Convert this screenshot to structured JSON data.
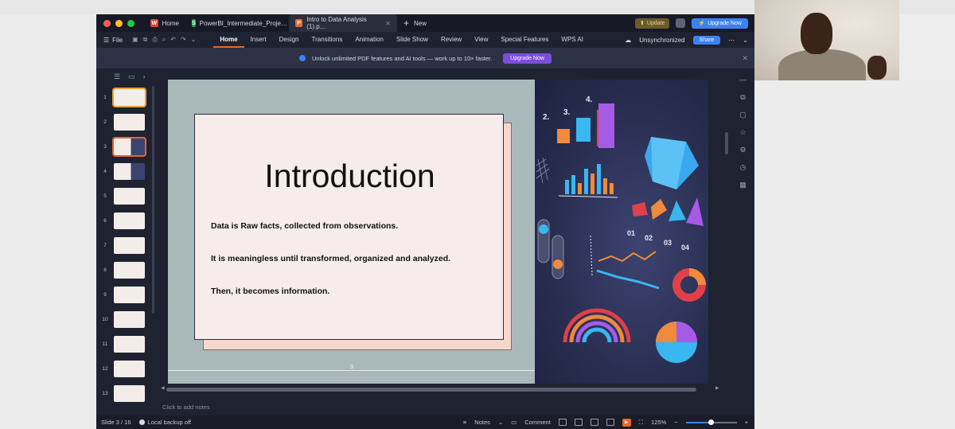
{
  "window": {
    "tabs": [
      {
        "label": "Home",
        "icon": "wps-logo-icon"
      },
      {
        "label": "PowerBI_Intermediate_Proje…",
        "icon": "spreadsheet-icon"
      },
      {
        "label": "Intro to Data Analysis (1).p…",
        "icon": "presentation-icon"
      }
    ],
    "new_tab_label": "New",
    "update_label": "Update",
    "upgrade_now_label": "Upgrade Now"
  },
  "menu": {
    "file_label": "File",
    "items": [
      "Home",
      "Insert",
      "Design",
      "Transitions",
      "Animation",
      "Slide Show",
      "Review",
      "View",
      "Special Features",
      "WPS AI"
    ],
    "active": "Home",
    "sync_status": "Unsynchronized",
    "share_label": "Share"
  },
  "banner": {
    "text": "Unlock unlimited PDF features and AI tools — work up to 10× faster.",
    "button_label": "Upgrade Now"
  },
  "thumbnails": {
    "numbers": [
      "1",
      "2",
      "3",
      "4",
      "5",
      "6",
      "7",
      "8",
      "9",
      "10",
      "11",
      "12",
      "13"
    ],
    "current": 3
  },
  "slide": {
    "title": "Introduction",
    "lines": [
      "Data is Raw facts, collected from observations.",
      "It is meaningless until transformed, organized and analyzed.",
      "Then, it becomes information."
    ],
    "page_number": "3",
    "art_labels": {
      "steps": [
        "2.",
        "3.",
        "4."
      ],
      "codes": [
        "01",
        "02",
        "03",
        "04"
      ]
    }
  },
  "notes_placeholder": "Click to add notes",
  "status": {
    "slide_info": "Slide 3 / 16",
    "backup": "Local backup off",
    "notes_label": "Notes",
    "comment_label": "Comment",
    "zoom": "125%"
  },
  "colors": {
    "accent": "#e8662a",
    "primary_blue": "#3b82f6",
    "upgrade_purple": "#7c4ddc",
    "slide_background": "#a9b9bb",
    "card_fill": "#f7ecec",
    "card_shadow": "#f7d7cd"
  }
}
